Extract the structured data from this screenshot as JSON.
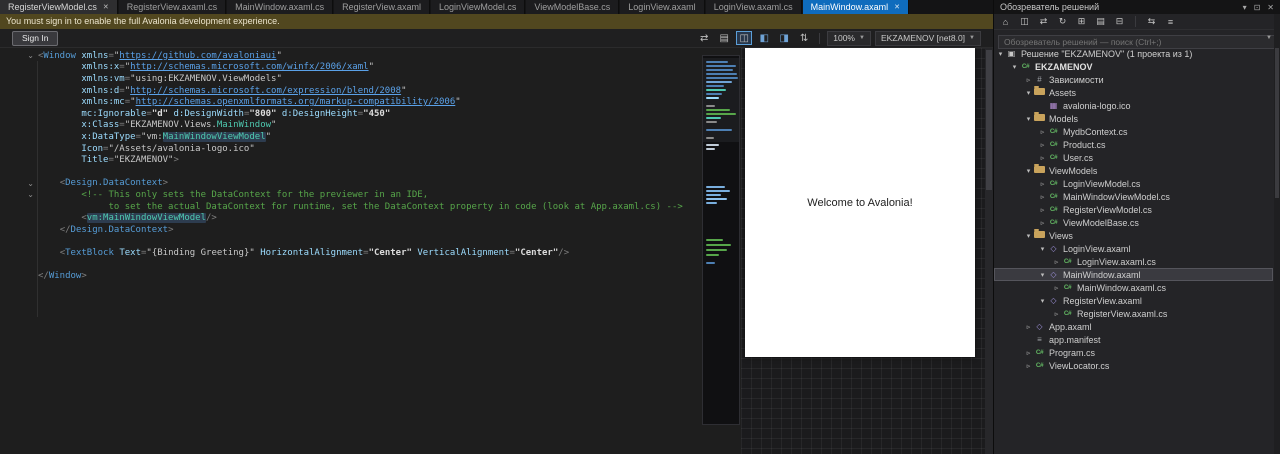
{
  "tab_bar": {
    "tabs": [
      {
        "label": "RegisterViewModel.cs",
        "state": "highlight",
        "close": true
      },
      {
        "label": "RegisterView.axaml.cs",
        "state": "plain"
      },
      {
        "label": "MainWindow.axaml.cs",
        "state": "plain"
      },
      {
        "label": "RegisterView.axaml",
        "state": "plain"
      },
      {
        "label": "LoginViewModel.cs",
        "state": "plain"
      },
      {
        "label": "ViewModelBase.cs",
        "state": "plain"
      },
      {
        "label": "LoginView.axaml",
        "state": "plain"
      },
      {
        "label": "LoginView.axaml.cs",
        "state": "plain"
      },
      {
        "label": "MainWindow.axaml",
        "state": "active",
        "close": true
      }
    ]
  },
  "infobar": {
    "message": "You must sign in to enable the full Avalonia development experience.",
    "action_label": "Sign In"
  },
  "designer_toolbar": {
    "icons": [
      {
        "name": "compare-icon",
        "glyph": "⇄"
      },
      {
        "name": "document-view-icon",
        "glyph": "▤"
      },
      {
        "name": "split-view-icon",
        "glyph": "◫",
        "active": true
      },
      {
        "name": "design-pane-icon",
        "glyph": "◧",
        "accent": true
      },
      {
        "name": "xaml-pane-icon",
        "glyph": "◨",
        "accent": true
      },
      {
        "name": "swap-panes-icon",
        "glyph": "⇅"
      }
    ],
    "zoom_value": "100%",
    "target_value": "EKZAMENOV [net8.0]"
  },
  "editor": {
    "lines": [
      {
        "fold": true,
        "s": [
          [
            "p",
            "<"
          ],
          [
            "tag",
            "Window"
          ],
          [
            "v",
            " "
          ],
          [
            "at",
            "xmlns"
          ],
          [
            "p",
            "="
          ],
          [
            "v",
            "\""
          ],
          [
            "lk",
            "https://github.com/avaloniaui"
          ],
          [
            "v",
            "\""
          ]
        ]
      },
      {
        "s": [
          [
            "v",
            "        "
          ],
          [
            "at",
            "xmlns:x"
          ],
          [
            "p",
            "="
          ],
          [
            "v",
            "\""
          ],
          [
            "lk",
            "http://schemas.microsoft.com/winfx/2006/xaml"
          ],
          [
            "v",
            "\""
          ]
        ]
      },
      {
        "s": [
          [
            "v",
            "        "
          ],
          [
            "at",
            "xmlns:vm"
          ],
          [
            "p",
            "="
          ],
          [
            "v",
            "\"using:EKZAMENOV.ViewModels\""
          ]
        ]
      },
      {
        "s": [
          [
            "v",
            "        "
          ],
          [
            "at",
            "xmlns:d"
          ],
          [
            "p",
            "="
          ],
          [
            "v",
            "\""
          ],
          [
            "lk",
            "http://schemas.microsoft.com/expression/blend/2008"
          ],
          [
            "v",
            "\""
          ]
        ]
      },
      {
        "s": [
          [
            "v",
            "        "
          ],
          [
            "at",
            "xmlns:mc"
          ],
          [
            "p",
            "="
          ],
          [
            "v",
            "\""
          ],
          [
            "lk",
            "http://schemas.openxmlformats.org/markup-compatibility/2006"
          ],
          [
            "v",
            "\""
          ]
        ]
      },
      {
        "s": [
          [
            "v",
            "        "
          ],
          [
            "at",
            "mc:Ignorable"
          ],
          [
            "p",
            "="
          ],
          [
            "n",
            "\"d\""
          ],
          [
            "v",
            " "
          ],
          [
            "at",
            "d:DesignWidth"
          ],
          [
            "p",
            "="
          ],
          [
            "n",
            "\"800\""
          ],
          [
            "v",
            " "
          ],
          [
            "at",
            "d:DesignHeight"
          ],
          [
            "p",
            "="
          ],
          [
            "n",
            "\"450\""
          ]
        ]
      },
      {
        "s": [
          [
            "v",
            "        "
          ],
          [
            "at",
            "x:Class"
          ],
          [
            "p",
            "="
          ],
          [
            "v",
            "\"EKZAMENOV.Views."
          ],
          [
            "cl",
            "MainWindow"
          ],
          [
            "v",
            "\""
          ]
        ]
      },
      {
        "s": [
          [
            "v",
            "        "
          ],
          [
            "at",
            "x:DataType"
          ],
          [
            "p",
            "="
          ],
          [
            "v",
            "\"vm:"
          ],
          [
            "clh",
            "MainWindowViewModel"
          ],
          [
            "v",
            "\""
          ]
        ]
      },
      {
        "s": [
          [
            "v",
            "        "
          ],
          [
            "at",
            "Icon"
          ],
          [
            "p",
            "="
          ],
          [
            "v",
            "\"/Assets/avalonia-logo.ico\""
          ]
        ]
      },
      {
        "s": [
          [
            "v",
            "        "
          ],
          [
            "at",
            "Title"
          ],
          [
            "p",
            "="
          ],
          [
            "v",
            "\"EKZAMENOV\""
          ],
          [
            "p",
            ">"
          ]
        ]
      },
      {
        "s": []
      },
      {
        "fold": true,
        "s": [
          [
            "v",
            "    "
          ],
          [
            "p",
            "<"
          ],
          [
            "tag",
            "Design.DataContext"
          ],
          [
            "p",
            ">"
          ]
        ]
      },
      {
        "fold": true,
        "s": [
          [
            "v",
            "        "
          ],
          [
            "cm",
            "<!-- This only sets the DataContext for the previewer in an IDE,"
          ]
        ]
      },
      {
        "s": [
          [
            "v",
            "             "
          ],
          [
            "cm",
            "to set the actual DataContext for runtime, set the DataContext property in code (look at App.axaml.cs) -->"
          ]
        ]
      },
      {
        "s": [
          [
            "v",
            "        "
          ],
          [
            "p",
            "<"
          ],
          [
            "clh",
            "vm:MainWindowViewModel"
          ],
          [
            "p",
            "/>"
          ]
        ]
      },
      {
        "s": [
          [
            "v",
            "    "
          ],
          [
            "p",
            "</"
          ],
          [
            "tag",
            "Design.DataContext"
          ],
          [
            "p",
            ">"
          ]
        ]
      },
      {
        "s": []
      },
      {
        "s": [
          [
            "v",
            "    "
          ],
          [
            "p",
            "<"
          ],
          [
            "tag",
            "TextBlock"
          ],
          [
            "v",
            " "
          ],
          [
            "at",
            "Text"
          ],
          [
            "p",
            "="
          ],
          [
            "v",
            "\"{Binding Greeting}\""
          ],
          [
            "v",
            " "
          ],
          [
            "at",
            "HorizontalAlignment"
          ],
          [
            "p",
            "="
          ],
          [
            "n",
            "\"Center\""
          ],
          [
            "v",
            " "
          ],
          [
            "at",
            "VerticalAlignment"
          ],
          [
            "p",
            "="
          ],
          [
            "n",
            "\"Center\""
          ],
          [
            "p",
            "/>"
          ]
        ]
      },
      {
        "s": []
      },
      {
        "s": [
          [
            "p",
            "</"
          ],
          [
            "tag",
            "Window"
          ],
          [
            "p",
            ">"
          ]
        ]
      }
    ]
  },
  "preview": {
    "greeting": "Welcome to Avalonia!"
  },
  "minimap": {
    "marks": [
      [
        5,
        22,
        "#4d7fb3"
      ],
      [
        9,
        30,
        "#4d7fb3"
      ],
      [
        13,
        27,
        "#4d7fb3"
      ],
      [
        17,
        31,
        "#4d7fb3"
      ],
      [
        21,
        32,
        "#4d7fb3"
      ],
      [
        25,
        26,
        "#6fa3d6"
      ],
      [
        29,
        18,
        "#4d7fb3"
      ],
      [
        33,
        20,
        "#4ec9b0"
      ],
      [
        37,
        16,
        "#4d7fb3"
      ],
      [
        41,
        13,
        "#9cdcfe"
      ],
      [
        49,
        9,
        "#8a8a8a"
      ],
      [
        53,
        24,
        "#57a64a"
      ],
      [
        57,
        30,
        "#57a64a"
      ],
      [
        61,
        15,
        "#4ec9b0"
      ],
      [
        65,
        11,
        "#8a8a8a"
      ],
      [
        73,
        26,
        "#4d7fb3"
      ],
      [
        81,
        8,
        "#8a8a8a"
      ],
      [
        88,
        13,
        "#c0ccd8"
      ],
      [
        92,
        9,
        "#c0ccd8"
      ],
      [
        130,
        19,
        "#79aede"
      ],
      [
        134,
        24,
        "#79aede"
      ],
      [
        138,
        15,
        "#79aede"
      ],
      [
        142,
        21,
        "#8cc0ec"
      ],
      [
        146,
        11,
        "#79aede"
      ],
      [
        183,
        17,
        "#57a64a"
      ],
      [
        188,
        25,
        "#57a64a"
      ],
      [
        193,
        21,
        "#57a64a"
      ],
      [
        198,
        13,
        "#57a64a"
      ],
      [
        206,
        9,
        "#4d7fb3"
      ]
    ]
  },
  "solution_explorer": {
    "title": "Обозреватель решений",
    "header_icons": [
      {
        "name": "chevron-down-icon",
        "glyph": "▾"
      },
      {
        "name": "dock-icon",
        "glyph": "⊡"
      },
      {
        "name": "close-icon",
        "glyph": "✕"
      }
    ],
    "toolbar_icons": [
      {
        "name": "home-icon",
        "glyph": "⌂"
      },
      {
        "name": "switch-views-icon",
        "glyph": "◫"
      },
      {
        "name": "sync-selection-icon",
        "glyph": "⇄"
      },
      {
        "name": "refresh-icon",
        "glyph": "↻"
      },
      {
        "name": "nest-files-icon",
        "glyph": "⊞"
      },
      {
        "name": "show-all-files-icon",
        "glyph": "▤"
      },
      {
        "name": "collapse-all-icon",
        "glyph": "⊟"
      },
      {
        "name": "separator"
      },
      {
        "name": "sync-active-document-icon",
        "glyph": "⇆"
      },
      {
        "name": "properties-icon",
        "glyph": "≡"
      }
    ],
    "search_placeholder": "Обозреватель решений — поиск (Ctrl+;)",
    "icon_defs": {
      "solution": {
        "glyph": "▣",
        "color": "#c8c8c8"
      },
      "project": {
        "glyph": "C#",
        "color": "#62b562",
        "cs": true
      },
      "deps": {
        "glyph": "#",
        "color": "#9da0a6"
      },
      "folder": {
        "shape": "folder"
      },
      "image": {
        "glyph": "▦",
        "color": "#b78fd6"
      },
      "cs": {
        "glyph": "C#",
        "color": "#62b562",
        "cs": true
      },
      "xaml": {
        "glyph": "◇",
        "color": "#9b8fd6"
      },
      "manifest": {
        "glyph": "≡",
        "color": "#9da0a6"
      }
    },
    "tree": [
      {
        "indent": 0,
        "arrow": "exp",
        "icon": "solution",
        "label": "Решение \"EKZAMENOV\" (1 проекта из 1)"
      },
      {
        "indent": 1,
        "arrow": "exp",
        "icon": "project",
        "label": "EKZAMENOV",
        "bold": true
      },
      {
        "indent": 2,
        "arrow": "col",
        "icon": "deps",
        "label": "Зависимости"
      },
      {
        "indent": 2,
        "arrow": "exp",
        "icon": "folder",
        "label": "Assets"
      },
      {
        "indent": 3,
        "arrow": "none",
        "icon": "image",
        "label": "avalonia-logo.ico"
      },
      {
        "indent": 2,
        "arrow": "exp",
        "icon": "folder",
        "label": "Models"
      },
      {
        "indent": 3,
        "arrow": "col",
        "icon": "cs",
        "label": "MydbContext.cs"
      },
      {
        "indent": 3,
        "arrow": "col",
        "icon": "cs",
        "label": "Product.cs"
      },
      {
        "indent": 3,
        "arrow": "col",
        "icon": "cs",
        "label": "User.cs"
      },
      {
        "indent": 2,
        "arrow": "exp",
        "icon": "folder",
        "label": "ViewModels"
      },
      {
        "indent": 3,
        "arrow": "col",
        "icon": "cs",
        "label": "LoginViewModel.cs"
      },
      {
        "indent": 3,
        "arrow": "col",
        "icon": "cs",
        "label": "MainWindowViewModel.cs"
      },
      {
        "indent": 3,
        "arrow": "col",
        "icon": "cs",
        "label": "RegisterViewModel.cs"
      },
      {
        "indent": 3,
        "arrow": "col",
        "icon": "cs",
        "label": "ViewModelBase.cs"
      },
      {
        "indent": 2,
        "arrow": "exp",
        "icon": "folder",
        "label": "Views"
      },
      {
        "indent": 3,
        "arrow": "exp",
        "icon": "xaml",
        "label": "LoginView.axaml"
      },
      {
        "indent": 4,
        "arrow": "col",
        "icon": "cs",
        "label": "LoginView.axaml.cs"
      },
      {
        "indent": 3,
        "arrow": "exp",
        "icon": "xaml",
        "label": "MainWindow.axaml",
        "selected": true
      },
      {
        "indent": 4,
        "arrow": "col",
        "icon": "cs",
        "label": "MainWindow.axaml.cs"
      },
      {
        "indent": 3,
        "arrow": "exp",
        "icon": "xaml",
        "label": "RegisterView.axaml"
      },
      {
        "indent": 4,
        "arrow": "col",
        "icon": "cs",
        "label": "RegisterView.axaml.cs"
      },
      {
        "indent": 2,
        "arrow": "col",
        "icon": "xaml",
        "label": "App.axaml"
      },
      {
        "indent": 2,
        "arrow": "none",
        "icon": "manifest",
        "label": "app.manifest"
      },
      {
        "indent": 2,
        "arrow": "col",
        "icon": "cs",
        "label": "Program.cs"
      },
      {
        "indent": 2,
        "arrow": "col",
        "icon": "cs",
        "label": "ViewLocator.cs"
      }
    ]
  }
}
